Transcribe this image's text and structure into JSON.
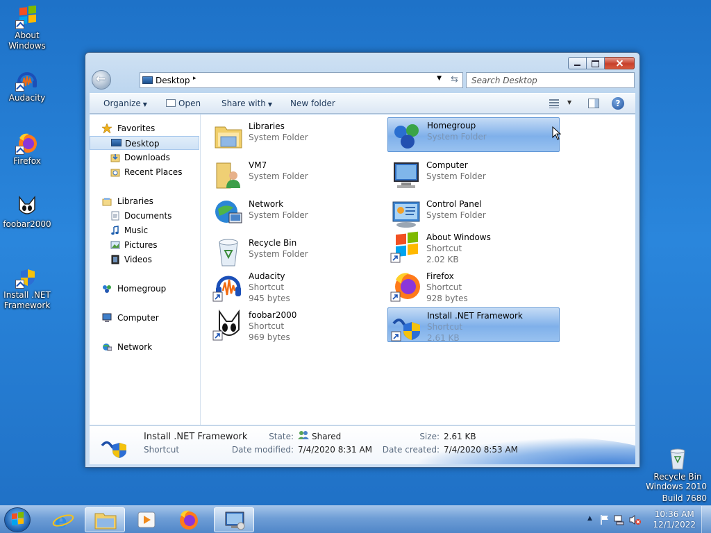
{
  "desktop": {
    "icons": [
      {
        "label_1": "About",
        "label_2": "Windows"
      },
      {
        "label_1": "Audacity",
        "label_2": ""
      },
      {
        "label_1": "Firefox",
        "label_2": ""
      },
      {
        "label_1": "foobar2000",
        "label_2": ""
      },
      {
        "label_1": "Install .NET",
        "label_2": "Framework"
      },
      {
        "label_1": "Recycle Bin",
        "label_2": ""
      }
    ],
    "watermark": {
      "line1": "Windows 2010",
      "line2": "Build 7680"
    }
  },
  "window": {
    "address": {
      "crumb": "Desktop",
      "crumb_arrow": "▸",
      "drop_arrow": "▼",
      "refresh": "⇆"
    },
    "search_placeholder": "Search Desktop",
    "toolbar": {
      "organize": "Organize",
      "open": "Open",
      "share_with": "Share with",
      "new_folder": "New folder",
      "caret": "▼",
      "help": "?"
    },
    "nav": {
      "favorites": "Favorites",
      "desktop": "Desktop",
      "downloads": "Downloads",
      "recent_places": "Recent Places",
      "libraries": "Libraries",
      "documents": "Documents",
      "music": "Music",
      "pictures": "Pictures",
      "videos": "Videos",
      "homegroup": "Homegroup",
      "computer": "Computer",
      "network": "Network"
    },
    "files": [
      {
        "name": "Libraries",
        "type": "System Folder",
        "size": ""
      },
      {
        "name": "Homegroup",
        "type": "System Folder",
        "size": ""
      },
      {
        "name": "VM7",
        "type": "System Folder",
        "size": ""
      },
      {
        "name": "Computer",
        "type": "System Folder",
        "size": ""
      },
      {
        "name": "Network",
        "type": "System Folder",
        "size": ""
      },
      {
        "name": "Control Panel",
        "type": "System Folder",
        "size": ""
      },
      {
        "name": "Recycle Bin",
        "type": "System Folder",
        "size": ""
      },
      {
        "name": "About Windows",
        "type": "Shortcut",
        "size": "2.02 KB"
      },
      {
        "name": "Audacity",
        "type": "Shortcut",
        "size": "945 bytes"
      },
      {
        "name": "Firefox",
        "type": "Shortcut",
        "size": "928 bytes"
      },
      {
        "name": "foobar2000",
        "type": "Shortcut",
        "size": "969 bytes"
      },
      {
        "name": "Install .NET Framework",
        "type": "Shortcut",
        "size": "2.61 KB"
      }
    ],
    "details": {
      "name": "Install .NET Framework",
      "type": "Shortcut",
      "state_label": "State:",
      "state_value": "Shared",
      "size_label": "Size:",
      "size_value": "2.61 KB",
      "modified_label": "Date modified:",
      "modified_value": "7/4/2020 8:31 AM",
      "created_label": "Date created:",
      "created_value": "7/4/2020 8:53 AM"
    }
  },
  "taskbar": {
    "tray_up_arrow": "▲",
    "time": "10:36 AM",
    "date": "12/1/2022"
  },
  "colors": {
    "desktop_blue": "#2a86dc",
    "selection_blue": "#7fb0ea",
    "close_red": "#c7402b"
  }
}
